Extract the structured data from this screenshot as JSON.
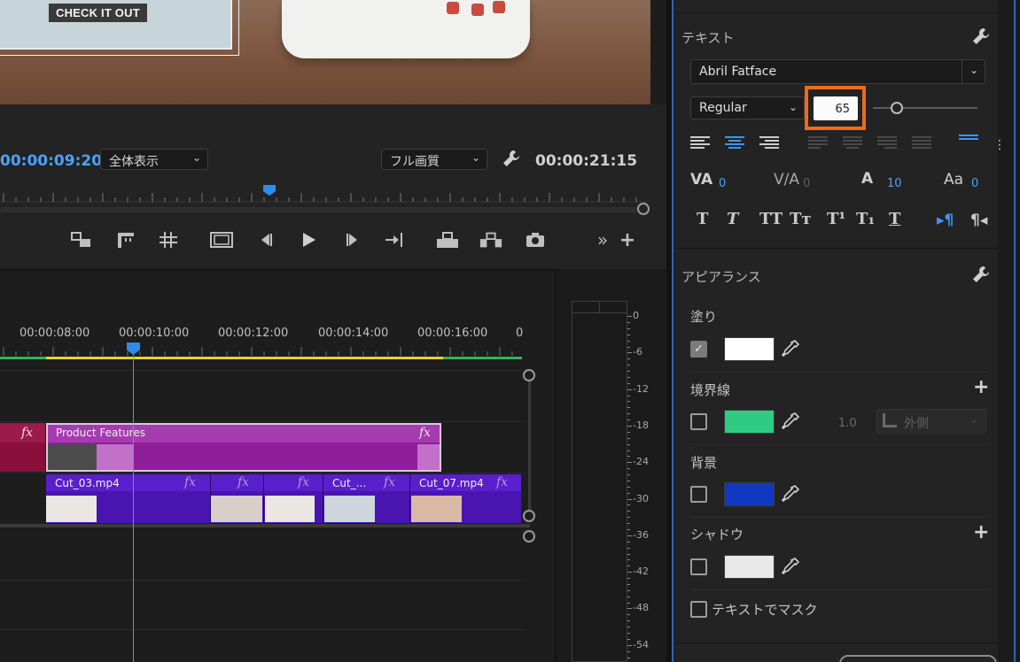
{
  "monitor": {
    "preview_caption": "CHECK IT OUT",
    "current_timecode": "00:00:09:20",
    "zoom_select": "全体表示",
    "quality_select": "フル画質",
    "duration_timecode": "00:00:21:15",
    "transport_buttons": [
      "add-marker",
      "mark-in",
      "mark-out",
      "safe-margins",
      "step-back",
      "play",
      "step-forward",
      "go-to-out",
      "lift",
      "extract",
      "export-frame",
      "more",
      "add"
    ]
  },
  "timeline": {
    "ruler_labels": [
      "00:00:08:00",
      "00:00:10:00",
      "00:00:12:00",
      "00:00:14:00",
      "00:00:16:00",
      "0"
    ],
    "title_clip": {
      "label": "Product Features",
      "fx": "fx"
    },
    "left_clip_fx": "fx",
    "video_clips": [
      {
        "label": "Cut_03.mp4",
        "fx": "fx"
      },
      {
        "label": "",
        "fx": "fx"
      },
      {
        "label": "",
        "fx": "fx"
      },
      {
        "label": "Cut_...",
        "fx": "fx"
      },
      {
        "label": "Cut_07.mp4",
        "fx": "fx"
      }
    ]
  },
  "meter": {
    "db_labels": [
      "0",
      "-6",
      "-12",
      "-18",
      "-24",
      "-30",
      "-36",
      "-42",
      "-48",
      "-54"
    ]
  },
  "essential_graphics": {
    "text_section": {
      "title": "テキスト",
      "font": "Abril Fatface",
      "style": "Regular",
      "font_size": "65",
      "kerning": "0",
      "tracking": "0",
      "leading": "10",
      "baseline_shift": "0",
      "kerning_icon": "VA",
      "tracking_icon": "V/A",
      "leading_icon": "A",
      "baseline_icon": "Aa",
      "style_buttons": [
        "T",
        "T",
        "TT",
        "Tт",
        "T¹",
        "T₁",
        "T"
      ]
    },
    "appearance_section": {
      "title": "アピアランス",
      "fill": {
        "label": "塗り",
        "checked": true,
        "color": "#ffffff"
      },
      "stroke": {
        "label": "境界線",
        "checked": false,
        "color": "#2dcc82",
        "width": "1.0",
        "position": "外側"
      },
      "background": {
        "label": "背景",
        "checked": false,
        "color": "#1138c0"
      },
      "shadow": {
        "label": "シャドウ",
        "checked": false,
        "color": "#e8e8e8"
      },
      "mask_label": "テキストでマスク",
      "mask_checked": false
    },
    "accent_color": "#ef6b19"
  }
}
